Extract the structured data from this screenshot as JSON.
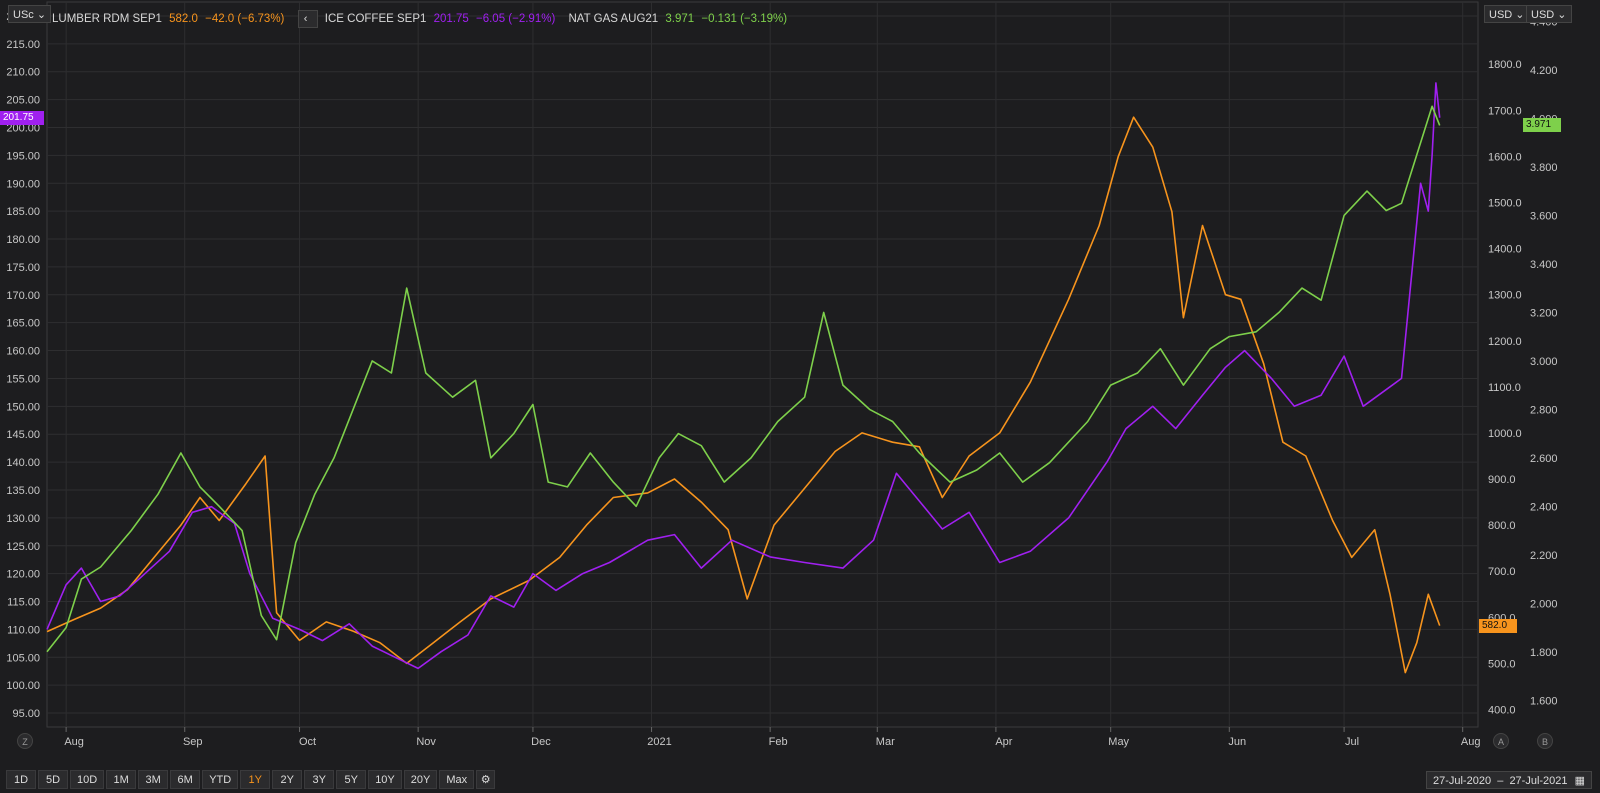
{
  "header": {
    "left_unit": "USc",
    "right_unit_1": "USD",
    "right_unit_2": "USD"
  },
  "legend": [
    {
      "name": "LUMBER RDM SEP1",
      "last": "582.0",
      "change": "−42.0 (−6.73%)",
      "color": "#f7941d"
    },
    {
      "name": "ICE COFFEE SEP1",
      "last": "201.75",
      "change": "−6.05 (−2.91%)",
      "color": "#a020f0"
    },
    {
      "name": "NAT GAS AUG21",
      "last": "3.971",
      "change": "−0.131 (−3.19%)",
      "color": "#7ed04b"
    }
  ],
  "tags": {
    "coffee_last": "201.75",
    "natgas_last": "3.971",
    "lumber_last": "582.0"
  },
  "colors": {
    "lumber": "#f7941d",
    "coffee": "#a020f0",
    "natgas": "#7ed04b",
    "background": "#1d1d1f",
    "grid": "#2e2e30"
  },
  "toolbar": {
    "ranges": [
      "1D",
      "5D",
      "10D",
      "1M",
      "3M",
      "6M",
      "YTD",
      "1Y",
      "2Y",
      "3Y",
      "5Y",
      "10Y",
      "20Y",
      "Max"
    ],
    "active": "1Y",
    "settings_icon": "gear-icon"
  },
  "date_range": {
    "from": "27-Jul-2020",
    "sep": "–",
    "to": "27-Jul-2021",
    "icon": "calendar-icon"
  },
  "axis_buttons": {
    "left": "Z",
    "right_a": "A",
    "right_b": "B"
  },
  "chart_data": {
    "type": "line",
    "x_tick_labels": [
      "Aug",
      "Sep",
      "Oct",
      "Nov",
      "Dec",
      "2021",
      "Feb",
      "Mar",
      "Apr",
      "May",
      "Jun",
      "Jul",
      "Aug"
    ],
    "x_tick_dates": [
      "2020-08-01",
      "2020-09-01",
      "2020-10-01",
      "2020-11-01",
      "2020-12-01",
      "2021-01-01",
      "2021-02-01",
      "2021-03-01",
      "2021-04-01",
      "2021-05-01",
      "2021-06-01",
      "2021-07-01",
      "2021-08-01"
    ],
    "x_range": [
      "2020-07-27",
      "2021-08-05"
    ],
    "axes": {
      "left": {
        "unit": "USc",
        "ylim": [
          92.5,
          222.5
        ],
        "ticks": [
          95,
          100,
          105,
          110,
          115,
          120,
          125,
          130,
          135,
          140,
          145,
          150,
          155,
          160,
          165,
          170,
          175,
          180,
          185,
          190,
          195,
          200,
          205,
          210,
          215,
          220
        ]
      },
      "right1": {
        "unit": "USD",
        "ylim": [
          362,
          1935
        ],
        "ticks": [
          400,
          500,
          600,
          700,
          800,
          900,
          1000,
          1100,
          1200,
          1300,
          1400,
          1500,
          1600,
          1700,
          1800
        ]
      },
      "right2": {
        "unit": "USD",
        "ylim": [
          1.49,
          4.48
        ],
        "ticks": [
          1.6,
          1.8,
          2.0,
          2.2,
          2.4,
          2.6,
          2.8,
          3.0,
          3.2,
          3.4,
          3.6,
          3.8,
          4.0,
          4.2,
          4.4
        ]
      }
    },
    "grid": true,
    "series": [
      {
        "name": "LUMBER RDM SEP1",
        "axis": "right1",
        "color": "#f7941d",
        "points": [
          [
            "2020-07-27",
            569
          ],
          [
            "2020-08-03",
            595
          ],
          [
            "2020-08-10",
            620
          ],
          [
            "2020-08-17",
            660
          ],
          [
            "2020-08-24",
            730
          ],
          [
            "2020-08-31",
            800
          ],
          [
            "2020-09-05",
            860
          ],
          [
            "2020-09-10",
            810
          ],
          [
            "2020-09-17",
            890
          ],
          [
            "2020-09-22",
            950
          ],
          [
            "2020-09-25",
            610
          ],
          [
            "2020-10-01",
            550
          ],
          [
            "2020-10-08",
            590
          ],
          [
            "2020-10-15",
            570
          ],
          [
            "2020-10-22",
            545
          ],
          [
            "2020-10-29",
            500
          ],
          [
            "2020-11-05",
            545
          ],
          [
            "2020-11-12",
            590
          ],
          [
            "2020-11-20",
            640
          ],
          [
            "2020-11-30",
            680
          ],
          [
            "2020-12-08",
            730
          ],
          [
            "2020-12-15",
            800
          ],
          [
            "2020-12-22",
            860
          ],
          [
            "2020-12-31",
            870
          ],
          [
            "2021-01-07",
            900
          ],
          [
            "2021-01-14",
            850
          ],
          [
            "2021-01-21",
            790
          ],
          [
            "2021-01-26",
            640
          ],
          [
            "2021-02-02",
            800
          ],
          [
            "2021-02-10",
            880
          ],
          [
            "2021-02-18",
            960
          ],
          [
            "2021-02-25",
            1000
          ],
          [
            "2021-03-05",
            980
          ],
          [
            "2021-03-12",
            970
          ],
          [
            "2021-03-18",
            860
          ],
          [
            "2021-03-25",
            950
          ],
          [
            "2021-04-02",
            1000
          ],
          [
            "2021-04-10",
            1110
          ],
          [
            "2021-04-20",
            1290
          ],
          [
            "2021-04-28",
            1450
          ],
          [
            "2021-05-03",
            1600
          ],
          [
            "2021-05-07",
            1685
          ],
          [
            "2021-05-12",
            1620
          ],
          [
            "2021-05-17",
            1480
          ],
          [
            "2021-05-20",
            1250
          ],
          [
            "2021-05-25",
            1450
          ],
          [
            "2021-05-31",
            1300
          ],
          [
            "2021-06-04",
            1290
          ],
          [
            "2021-06-10",
            1150
          ],
          [
            "2021-06-15",
            980
          ],
          [
            "2021-06-21",
            950
          ],
          [
            "2021-06-28",
            810
          ],
          [
            "2021-07-03",
            730
          ],
          [
            "2021-07-09",
            790
          ],
          [
            "2021-07-13",
            650
          ],
          [
            "2021-07-17",
            480
          ],
          [
            "2021-07-20",
            545
          ],
          [
            "2021-07-23",
            650
          ],
          [
            "2021-07-26",
            582
          ]
        ]
      },
      {
        "name": "ICE COFFEE SEP1",
        "axis": "left",
        "color": "#a020f0",
        "points": [
          [
            "2020-07-27",
            110
          ],
          [
            "2020-08-01",
            118
          ],
          [
            "2020-08-05",
            121
          ],
          [
            "2020-08-10",
            115
          ],
          [
            "2020-08-15",
            116
          ],
          [
            "2020-08-20",
            119
          ],
          [
            "2020-08-28",
            124
          ],
          [
            "2020-09-03",
            131
          ],
          [
            "2020-09-08",
            132
          ],
          [
            "2020-09-14",
            129
          ],
          [
            "2020-09-18",
            120
          ],
          [
            "2020-09-24",
            112
          ],
          [
            "2020-10-01",
            110
          ],
          [
            "2020-10-07",
            108
          ],
          [
            "2020-10-14",
            111
          ],
          [
            "2020-10-20",
            107
          ],
          [
            "2020-10-26",
            105
          ],
          [
            "2020-11-01",
            103
          ],
          [
            "2020-11-07",
            106
          ],
          [
            "2020-11-14",
            109
          ],
          [
            "2020-11-20",
            116
          ],
          [
            "2020-11-26",
            114
          ],
          [
            "2020-12-01",
            120
          ],
          [
            "2020-12-07",
            117
          ],
          [
            "2020-12-14",
            120
          ],
          [
            "2020-12-21",
            122
          ],
          [
            "2020-12-31",
            126
          ],
          [
            "2021-01-07",
            127
          ],
          [
            "2021-01-14",
            121
          ],
          [
            "2021-01-22",
            126
          ],
          [
            "2021-02-01",
            123
          ],
          [
            "2021-02-10",
            122
          ],
          [
            "2021-02-20",
            121
          ],
          [
            "2021-02-28",
            126
          ],
          [
            "2021-03-06",
            138
          ],
          [
            "2021-03-12",
            133
          ],
          [
            "2021-03-18",
            128
          ],
          [
            "2021-03-25",
            131
          ],
          [
            "2021-04-02",
            122
          ],
          [
            "2021-04-10",
            124
          ],
          [
            "2021-04-20",
            130
          ],
          [
            "2021-04-30",
            140
          ],
          [
            "2021-05-05",
            146
          ],
          [
            "2021-05-12",
            150
          ],
          [
            "2021-05-18",
            146
          ],
          [
            "2021-05-25",
            152
          ],
          [
            "2021-05-31",
            157
          ],
          [
            "2021-06-05",
            160
          ],
          [
            "2021-06-12",
            155
          ],
          [
            "2021-06-18",
            150
          ],
          [
            "2021-06-25",
            152
          ],
          [
            "2021-07-01",
            159
          ],
          [
            "2021-07-06",
            150
          ],
          [
            "2021-07-10",
            152
          ],
          [
            "2021-07-16",
            155
          ],
          [
            "2021-07-21",
            190
          ],
          [
            "2021-07-23",
            185
          ],
          [
            "2021-07-24",
            195
          ],
          [
            "2021-07-25",
            208
          ],
          [
            "2021-07-26",
            201.75
          ]
        ]
      },
      {
        "name": "NAT GAS AUG21",
        "axis": "right2",
        "color": "#7ed04b",
        "points": [
          [
            "2020-07-27",
            1.8
          ],
          [
            "2020-08-01",
            1.9
          ],
          [
            "2020-08-05",
            2.1
          ],
          [
            "2020-08-10",
            2.15
          ],
          [
            "2020-08-18",
            2.3
          ],
          [
            "2020-08-25",
            2.45
          ],
          [
            "2020-08-31",
            2.62
          ],
          [
            "2020-09-05",
            2.48
          ],
          [
            "2020-09-10",
            2.4
          ],
          [
            "2020-09-16",
            2.3
          ],
          [
            "2020-09-21",
            1.95
          ],
          [
            "2020-09-25",
            1.85
          ],
          [
            "2020-09-30",
            2.25
          ],
          [
            "2020-10-05",
            2.45
          ],
          [
            "2020-10-10",
            2.6
          ],
          [
            "2020-10-15",
            2.8
          ],
          [
            "2020-10-20",
            3.0
          ],
          [
            "2020-10-25",
            2.95
          ],
          [
            "2020-10-29",
            3.3
          ],
          [
            "2020-11-03",
            2.95
          ],
          [
            "2020-11-10",
            2.85
          ],
          [
            "2020-11-16",
            2.92
          ],
          [
            "2020-11-20",
            2.6
          ],
          [
            "2020-11-26",
            2.7
          ],
          [
            "2020-12-01",
            2.82
          ],
          [
            "2020-12-05",
            2.5
          ],
          [
            "2020-12-10",
            2.48
          ],
          [
            "2020-12-16",
            2.62
          ],
          [
            "2020-12-22",
            2.5
          ],
          [
            "2020-12-28",
            2.4
          ],
          [
            "2021-01-03",
            2.6
          ],
          [
            "2021-01-08",
            2.7
          ],
          [
            "2021-01-14",
            2.65
          ],
          [
            "2021-01-20",
            2.5
          ],
          [
            "2021-01-27",
            2.6
          ],
          [
            "2021-02-03",
            2.75
          ],
          [
            "2021-02-10",
            2.85
          ],
          [
            "2021-02-15",
            3.2
          ],
          [
            "2021-02-20",
            2.9
          ],
          [
            "2021-02-27",
            2.8
          ],
          [
            "2021-03-05",
            2.75
          ],
          [
            "2021-03-12",
            2.62
          ],
          [
            "2021-03-20",
            2.5
          ],
          [
            "2021-03-27",
            2.55
          ],
          [
            "2021-04-02",
            2.62
          ],
          [
            "2021-04-08",
            2.5
          ],
          [
            "2021-04-15",
            2.58
          ],
          [
            "2021-04-25",
            2.75
          ],
          [
            "2021-05-01",
            2.9
          ],
          [
            "2021-05-08",
            2.95
          ],
          [
            "2021-05-14",
            3.05
          ],
          [
            "2021-05-20",
            2.9
          ],
          [
            "2021-05-27",
            3.05
          ],
          [
            "2021-06-01",
            3.1
          ],
          [
            "2021-06-08",
            3.12
          ],
          [
            "2021-06-14",
            3.2
          ],
          [
            "2021-06-20",
            3.3
          ],
          [
            "2021-06-25",
            3.25
          ],
          [
            "2021-07-01",
            3.6
          ],
          [
            "2021-07-07",
            3.7
          ],
          [
            "2021-07-12",
            3.62
          ],
          [
            "2021-07-16",
            3.65
          ],
          [
            "2021-07-20",
            3.85
          ],
          [
            "2021-07-24",
            4.05
          ],
          [
            "2021-07-26",
            3.971
          ]
        ]
      }
    ]
  }
}
